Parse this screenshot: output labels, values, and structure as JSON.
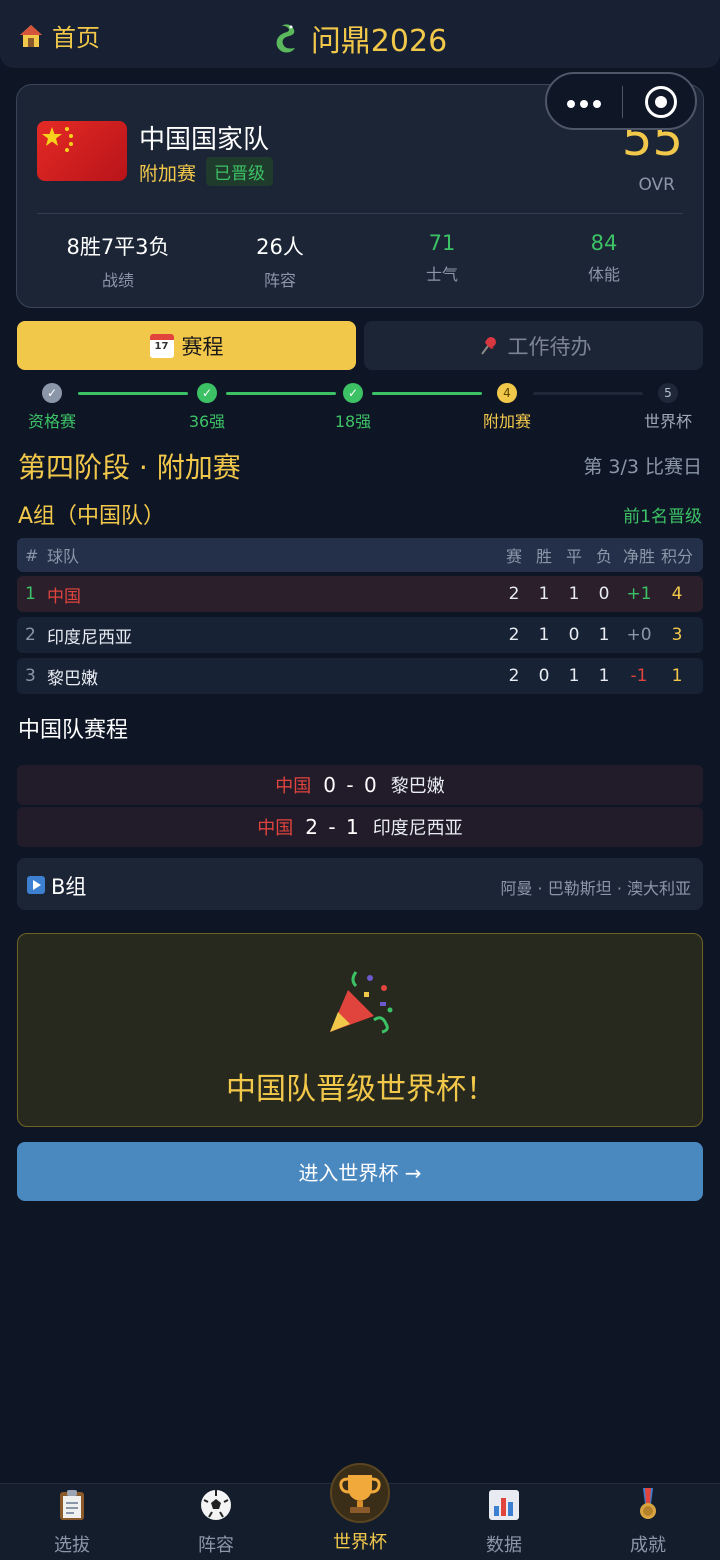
{
  "header": {
    "home_label": "首页",
    "app_title": "问鼎2026"
  },
  "team": {
    "name": "中国国家队",
    "stage": "附加赛",
    "status": "已晋级",
    "ovr": "55",
    "ovr_label": "OVR",
    "stats": [
      {
        "value": "8胜7平3负",
        "label": "战绩"
      },
      {
        "value": "26人",
        "label": "阵容"
      },
      {
        "value": "71",
        "label": "士气"
      },
      {
        "value": "84",
        "label": "体能"
      }
    ]
  },
  "tabs": [
    {
      "label": "赛程",
      "icon": "calendar-icon",
      "icon_text": "17"
    },
    {
      "label": "工作待办",
      "icon": "pin-icon"
    }
  ],
  "progress": [
    {
      "label": "资格赛",
      "node": "✓",
      "state": "gray"
    },
    {
      "label": "36强",
      "node": "✓",
      "state": "done"
    },
    {
      "label": "18强",
      "node": "✓",
      "state": "done"
    },
    {
      "label": "附加赛",
      "node": "4",
      "state": "current"
    },
    {
      "label": "世界杯",
      "node": "5",
      "state": "todo"
    }
  ],
  "stage_title": "第四阶段 · 附加赛",
  "matchday": "第 3/3 比赛日",
  "group": {
    "title": "A组（中国队）",
    "advance_note": "前1名晋级",
    "headers": {
      "rank": "#",
      "team": "球队",
      "played": "赛",
      "won": "胜",
      "draw": "平",
      "lost": "负",
      "gd": "净胜",
      "pts": "积分"
    },
    "rows": [
      {
        "rank": "1",
        "team": "中国",
        "played": "2",
        "won": "1",
        "draw": "1",
        "lost": "0",
        "gd": "+1",
        "pts": "4"
      },
      {
        "rank": "2",
        "team": "印度尼西亚",
        "played": "2",
        "won": "1",
        "draw": "0",
        "lost": "1",
        "gd": "+0",
        "pts": "3"
      },
      {
        "rank": "3",
        "team": "黎巴嫩",
        "played": "2",
        "won": "0",
        "draw": "1",
        "lost": "1",
        "gd": "-1",
        "pts": "1"
      }
    ]
  },
  "schedule": {
    "title": "中国队赛程",
    "matches": [
      {
        "home": "中国",
        "score": "0 - 0",
        "away": "黎巴嫩"
      },
      {
        "home": "中国",
        "score": "2 - 1",
        "away": "印度尼西亚"
      }
    ]
  },
  "group_b": {
    "label": "B组",
    "teams": "阿曼 · 巴勒斯坦 · 澳大利亚"
  },
  "celebration": {
    "text": "中国队晋级世界杯！"
  },
  "enter_button": "进入世界杯 →",
  "nav": [
    {
      "label": "选拔",
      "icon": "clipboard-icon"
    },
    {
      "label": "阵容",
      "icon": "soccer-ball-icon"
    },
    {
      "label": "世界杯",
      "icon": "trophy-icon",
      "active": true
    },
    {
      "label": "数据",
      "icon": "bar-chart-icon"
    },
    {
      "label": "成就",
      "icon": "medal-icon"
    }
  ],
  "colors": {
    "accent": "#f2c84b",
    "green": "#3cc265",
    "red": "#e0443c",
    "background": "#0e1626",
    "button": "#4a88c0"
  }
}
